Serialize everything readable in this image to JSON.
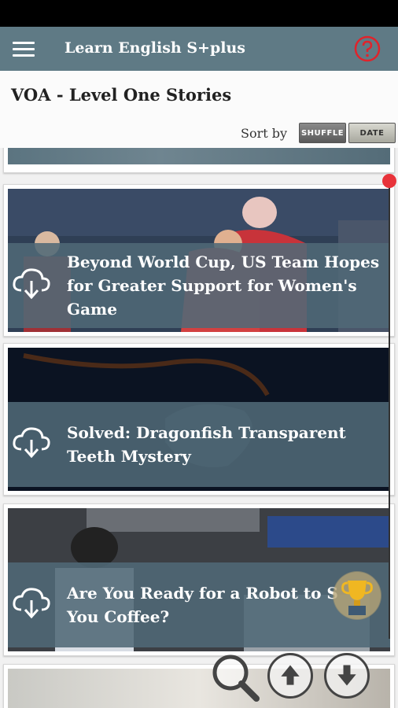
{
  "app": {
    "title": "Learn English S+plus"
  },
  "page": {
    "title": "VOA - Level One Stories"
  },
  "sort": {
    "label": "Sort by",
    "shuffle_label": "SHUFFLE",
    "date_label": "DATE"
  },
  "stories": [
    {
      "title_lines": [
        "Beyond World Cup, US Team Hopes",
        "for Greater Support for Women's",
        "Game"
      ]
    },
    {
      "title_lines": [
        "Solved: Dragonfish Transparent",
        "Teeth Mystery"
      ]
    },
    {
      "title_lines": [
        "Are You Ready for a Robot to S",
        "You Coffee?"
      ]
    }
  ],
  "colors": {
    "appbar": "#5f7a85",
    "overlay": "#506976",
    "help": "#e0232b",
    "scroll_dot": "#e8333a"
  },
  "icons": [
    "menu-icon",
    "help-icon",
    "cloud-download-icon",
    "trophy-icon",
    "search-icon",
    "arrow-up-icon",
    "arrow-down-icon"
  ]
}
